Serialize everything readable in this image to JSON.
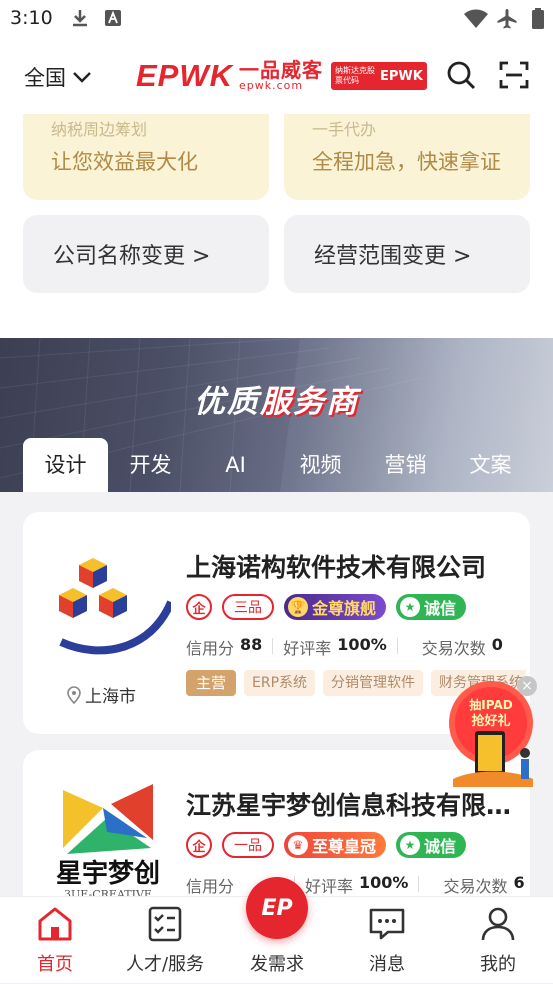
{
  "status_bar": {
    "time": "3:10"
  },
  "header": {
    "region": "全国",
    "logo_main": "EPWK",
    "logo_cn": "一品威客",
    "logo_en": "epwk.com",
    "logo_badge_small": "纳斯达克股票代码",
    "logo_badge_big": "EPWK"
  },
  "promos": [
    {
      "sub": "纳税周边筹划",
      "main": "让您效益最大化"
    },
    {
      "sub": "一手代办",
      "main": "全程加急，快速拿证"
    }
  ],
  "service_buttons": [
    {
      "label": "公司名称变更  >"
    },
    {
      "label": "经营范围变更  >"
    }
  ],
  "banner": {
    "title_part1": "优质",
    "title_part2": "服务商",
    "tabs": [
      "设计",
      "开发",
      "AI",
      "视频",
      "营销",
      "文案"
    ],
    "active_tab": "设计"
  },
  "providers": [
    {
      "name": "上海诺构软件技术有限公司",
      "circle_badge": "企",
      "level": "三品",
      "rank_badge": "金尊旗舰",
      "trust_badge": "诚信",
      "credit_label": "信用分",
      "credit_value": "88",
      "rating_label": "好评率",
      "rating_value": "100%",
      "deals_label": "交易次数",
      "deals_value": "0",
      "location": "上海市",
      "main_tag": "主营",
      "tags": [
        "ERP系统",
        "分销管理软件",
        "财务管理系统"
      ]
    },
    {
      "name": "江苏星宇梦创信息科技有限公司",
      "logo_text": "星宇梦创",
      "logo_sub": "3UE-CREATIVE",
      "circle_badge": "企",
      "level": "一品",
      "rank_badge": "至尊皇冠",
      "trust_badge": "诚信",
      "credit_label": "信用分",
      "rating_label": "好评率",
      "rating_value": "100%",
      "deals_label": "交易次数",
      "deals_value": "6"
    }
  ],
  "float_ad": {
    "line1": "抽IPAD",
    "line2": "抢好礼",
    "close": "×"
  },
  "tabbar": {
    "items": [
      "首页",
      "人才/服务",
      "发需求",
      "消息",
      "我的"
    ],
    "center_label": "EP",
    "active": "首页"
  },
  "colors": {
    "brand": "#e5262f",
    "gold": "#b08a46",
    "trust": "#2fb554"
  }
}
